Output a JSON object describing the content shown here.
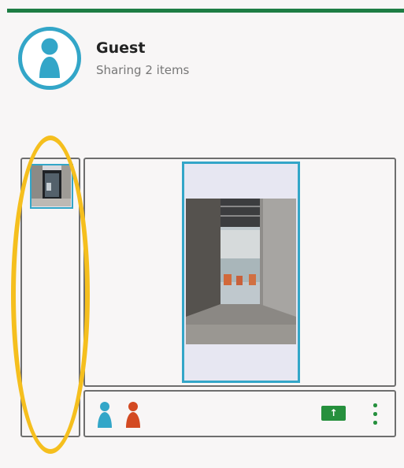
{
  "colors": {
    "accent": "#33a6c8",
    "topbar": "#1e7d44",
    "action_green": "#26903d",
    "participant_blue": "#33a6c8",
    "participant_red": "#d34a22",
    "highlight": "#f5bf1e"
  },
  "header": {
    "avatar_icon": "person-pawn-icon",
    "user_name": "Guest",
    "status": "Sharing 2 items"
  },
  "thumbnails": [
    {
      "selected": true,
      "icon": "photo-thumbnail"
    }
  ],
  "viewer": {
    "selected_item": 1
  },
  "footer": {
    "participants": [
      {
        "icon": "person-pawn-icon",
        "color": "#33a6c8"
      },
      {
        "icon": "person-pawn-icon",
        "color": "#d34a22"
      }
    ],
    "upload_icon": "↑",
    "more_icon": "more-vertical-icon"
  }
}
